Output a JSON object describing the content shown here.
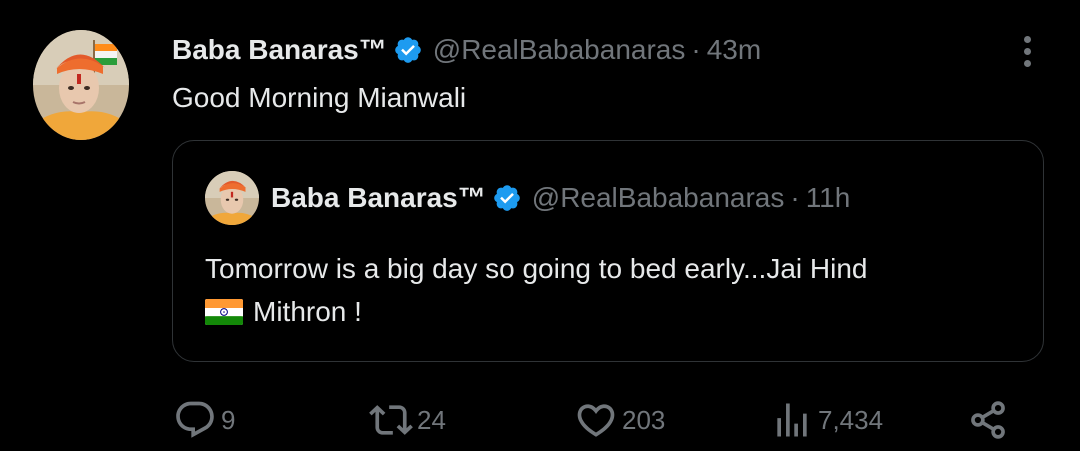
{
  "tweet": {
    "author_name": "Baba Banaras™",
    "handle": "@RealBababanaras",
    "separator": "·",
    "time": "43m",
    "text": "Good Morning Mianwali",
    "avatar_icon": "profile-avatar",
    "verified_icon": "verified-badge-icon",
    "verified_color": "#1d9bf0"
  },
  "quote": {
    "author_name": "Baba Banaras™",
    "handle": "@RealBababanaras",
    "separator": "·",
    "time": "11h",
    "text_line1": "Tomorrow is a big day so going to bed early...Jai Hind",
    "text_line2": "Mithron !",
    "flag_icon": "india-flag-icon"
  },
  "actions": {
    "reply_count": "9",
    "retweet_count": "24",
    "like_count": "203",
    "views_count": "7,434",
    "reply_icon": "reply-icon",
    "retweet_icon": "retweet-icon",
    "like_icon": "heart-icon",
    "views_icon": "views-icon",
    "share_icon": "share-icon"
  },
  "colors": {
    "background": "#000000",
    "primary_text": "#e7e9ea",
    "secondary_text": "#71767b",
    "border": "#2f3336",
    "accent": "#1d9bf0"
  }
}
